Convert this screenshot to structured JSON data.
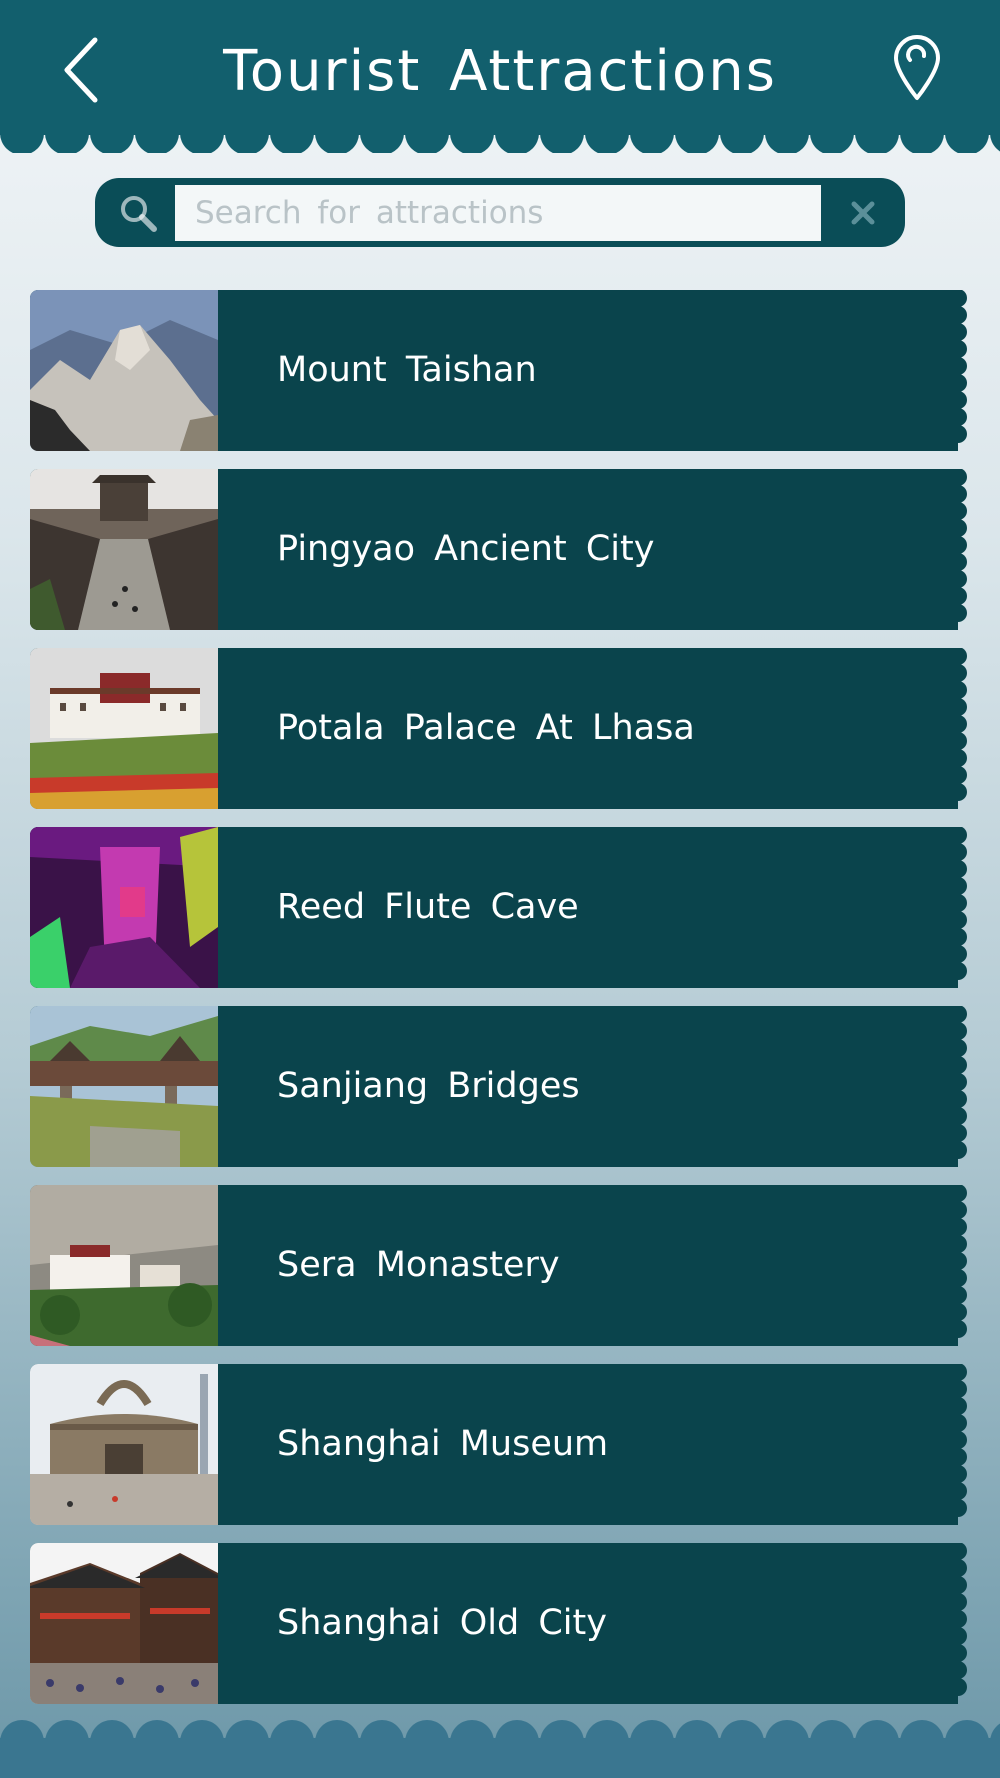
{
  "header": {
    "title": "Tourist Attractions",
    "back_icon": "chevron-left-icon",
    "location_icon": "map-pin-icon"
  },
  "search": {
    "placeholder": "Search for attractions",
    "value": "",
    "search_icon": "magnifier-icon",
    "clear_icon": "close-icon"
  },
  "attractions": [
    {
      "name": "Mount Taishan",
      "thumbnail": "mountain-cliffs-photo"
    },
    {
      "name": "Pingyao Ancient City",
      "thumbnail": "old-street-tower-photo"
    },
    {
      "name": "Potala Palace At Lhasa",
      "thumbnail": "palace-on-hill-photo"
    },
    {
      "name": "Reed Flute Cave",
      "thumbnail": "colorful-cave-photo"
    },
    {
      "name": "Sanjiang Bridges",
      "thumbnail": "covered-bridge-photo"
    },
    {
      "name": "Sera Monastery",
      "thumbnail": "monastery-hillside-photo"
    },
    {
      "name": "Shanghai Museum",
      "thumbnail": "round-museum-photo"
    },
    {
      "name": "Shanghai Old City",
      "thumbnail": "traditional-buildings-photo"
    }
  ],
  "colors": {
    "header_bg": "#125f6d",
    "item_bg": "#0a444c",
    "search_bg": "#0a4d57",
    "footer_bg": "#3a7690",
    "text": "#ffffff"
  }
}
